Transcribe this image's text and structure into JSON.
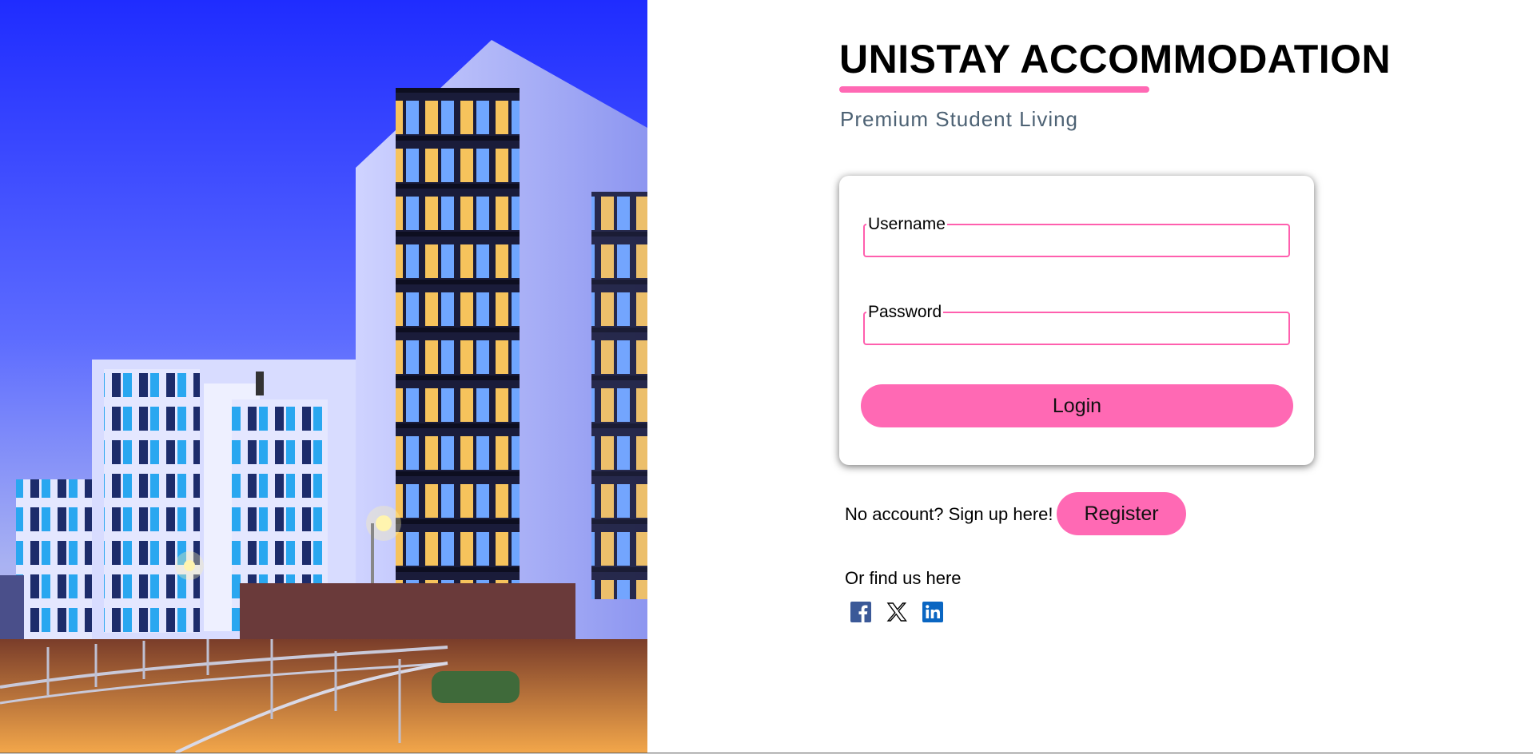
{
  "brand": {
    "title": "UNISTAY ACCOMMODATION",
    "tagline": "Premium Student Living",
    "accent_color": "#ff69b4"
  },
  "login_form": {
    "username_label": "Username",
    "username_value": "",
    "password_label": "Password",
    "password_value": "",
    "login_label": "Login"
  },
  "signup": {
    "prompt": "No account? Sign up here!",
    "register_label": "Register"
  },
  "social": {
    "heading": "Or find us here",
    "links": [
      {
        "icon": "facebook-icon",
        "color": "#3b5998"
      },
      {
        "icon": "x-icon",
        "color": "#000000"
      },
      {
        "icon": "linkedin-icon",
        "color": "#0a66c2"
      }
    ]
  },
  "hero_image": {
    "subject": "modern apartment buildings at dusk"
  }
}
